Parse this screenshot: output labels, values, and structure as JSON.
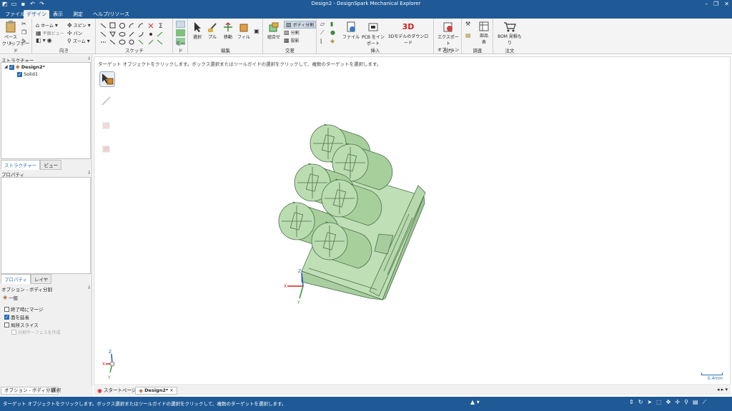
{
  "app": {
    "title": "Design2 - DesignSpark Mechanical Explorer"
  },
  "quick_access": [
    "file-new-icon",
    "folder-open-icon",
    "save-icon",
    "undo-icon",
    "redo-icon"
  ],
  "ribbon_tabs": [
    "ファイル",
    "デザイン",
    "表示",
    "測定",
    "ヘルプ/リソース"
  ],
  "active_tab": "デザイン",
  "ribbon": {
    "clipboard": {
      "label": "クリップボード",
      "paste": "ペースト"
    },
    "orient": {
      "label": "向き",
      "home": "ホーム",
      "plane_view": "平面ビュー",
      "spin": "スピン",
      "pan": "パン",
      "zoom": "ズーム"
    },
    "sketch": {
      "label": "スケッチ"
    },
    "mode": {
      "label": "モード"
    },
    "edit": {
      "label": "編集",
      "select": "選択",
      "pull": "プル",
      "move": "移動",
      "fill": "フィル"
    },
    "intersect": {
      "label": "交差",
      "combine": "組合せ",
      "split_body": "ボディ分割",
      "split": "分割",
      "project": "投影"
    },
    "insert": {
      "label": "挿入",
      "file": "ファイル",
      "pcb_line1": "PCB をイン",
      "pcb_line2": "ポート",
      "download3d": "3Dモデルのダウンロード",
      "badge_3d": "3D"
    },
    "output": {
      "label": "出力",
      "export_line1": "エクスポート",
      "export_line2": "オプション"
    },
    "investigate": {
      "label": "調査",
      "parts_line1": "部品",
      "parts_line2": "表"
    },
    "order": {
      "label": "注文",
      "bom_line1": "BOM 見積も",
      "bom_line2": "り"
    }
  },
  "structure_panel": {
    "header": "ストラクチャー",
    "root": "Design2*",
    "child": "Solid1",
    "tabs": [
      "ストラクチャー",
      "ビュー"
    ]
  },
  "properties_panel": {
    "header": "プロパティ",
    "tabs": [
      "プロパティ",
      "レイヤ"
    ]
  },
  "options_panel": {
    "header": "オプション - ボディ分割",
    "general": "一般",
    "options": [
      {
        "label": "終了時にマージ",
        "checked": false
      },
      {
        "label": "面を延長",
        "checked": true
      },
      {
        "label": "局所スライス",
        "checked": false
      },
      {
        "label": "分割サーフェスを作成",
        "checked": false,
        "disabled": true
      }
    ]
  },
  "left_bottom_tabs": [
    "オプション - ボディ分割",
    "選択"
  ],
  "viewport": {
    "hint": "ターゲット オブジェクトをクリックします。ボックス選択またはツールガイドの選択をクリックして、複数のターゲットを選択します。",
    "scale_label": "0.4mm",
    "axes": {
      "x": "X",
      "y": "Y",
      "z": "Z"
    },
    "model_color": "#b9dcb0",
    "model_edge": "#4c6f4a"
  },
  "doc_tabs": [
    {
      "label": "スタートページ",
      "active": false
    },
    {
      "label": "Design2*",
      "active": true
    }
  ],
  "status": {
    "text": "ターゲット オブジェクトをクリックします。ボックス選択またはツールガイドの選択をクリックして、複数のターゲットを選択します。"
  },
  "colors": {
    "brand": "#1f5a96",
    "accent": "#2d6db5",
    "axis_x": "#d02020",
    "axis_y": "#2a9a2a",
    "axis_z": "#2050c0"
  }
}
